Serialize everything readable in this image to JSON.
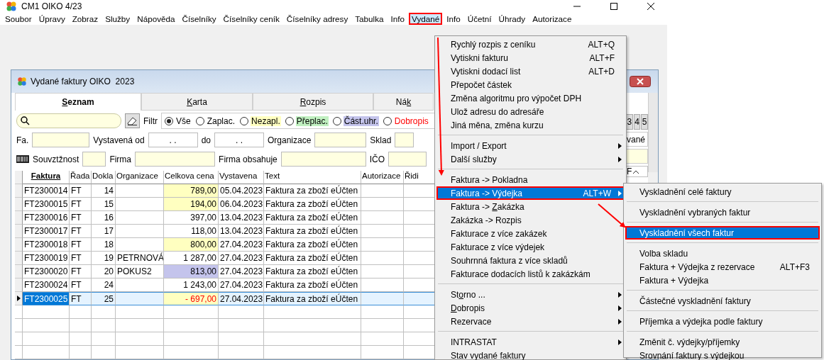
{
  "window": {
    "title": "CM1 OIKO 4/23"
  },
  "menu_bar": [
    {
      "label": "Soubor",
      "selected": false
    },
    {
      "label": "Úpravy",
      "selected": false
    },
    {
      "label": "Zobraz",
      "selected": false
    },
    {
      "label": "Služby",
      "selected": false
    },
    {
      "label": "Nápověda",
      "selected": false
    },
    {
      "label": "Číselníky",
      "selected": false
    },
    {
      "label": "Číselníky ceník",
      "selected": false
    },
    {
      "label": "Číselníky adresy",
      "selected": false
    },
    {
      "label": "Tabulka",
      "selected": false
    },
    {
      "label": "Info",
      "selected": false
    },
    {
      "label": "Vydané",
      "selected": true
    },
    {
      "label": "Info",
      "selected": false
    },
    {
      "label": "Účetní",
      "selected": false
    },
    {
      "label": "Úhrady",
      "selected": false
    },
    {
      "label": "Autorizace",
      "selected": false
    }
  ],
  "inner_window": {
    "title": "Vydané faktury OIKO  2023",
    "tabs": [
      {
        "label": {
          "key": "S",
          "post": "eznam"
        },
        "selected": true
      },
      {
        "label": {
          "key": "K",
          "post": "arta"
        },
        "selected": false
      },
      {
        "label": {
          "key": "R",
          "post": "ozpis"
        },
        "selected": false
      },
      {
        "label": {
          "pre": "Ná",
          "key": "k"
        },
        "selected": false
      }
    ],
    "filter": {
      "label": "Filtr",
      "options": [
        {
          "label": "Vše",
          "selected": true,
          "kind": "plain"
        },
        {
          "label": "Zaplac.",
          "selected": false,
          "kind": "plain"
        },
        {
          "label": "Nezapl.",
          "selected": false,
          "kind": "background",
          "color": "#ffffc0"
        },
        {
          "label": "Přeplac.",
          "selected": false,
          "kind": "background",
          "color": "#c0f0c0"
        },
        {
          "label": "Část.uhr.",
          "selected": false,
          "kind": "background",
          "color": "#c4c4ec"
        },
        {
          "label": "Dobropis",
          "selected": false,
          "kind": "text",
          "color": "#ff0000"
        }
      ]
    },
    "fields_row_1": [
      {
        "label": "Fa.",
        "kind": "yellow"
      },
      {
        "label": "Vystavená od",
        "kind": "date",
        "value": ". ."
      },
      {
        "label": "do",
        "kind": "date",
        "value": ". ."
      },
      {
        "label": "Organizace",
        "kind": "yellow"
      },
      {
        "label": "Sklad",
        "kind": "yellow"
      }
    ],
    "fields_row_2": [
      {
        "label": "Souvztžnost"
      },
      {
        "label": "Firma"
      },
      {
        "label": "Firma obsahuje"
      },
      {
        "label": "IČO"
      }
    ],
    "page_buttons": [
      "3",
      "4",
      "5"
    ],
    "side_field": "vané",
    "side_column": "F",
    "table": {
      "columns": [
        {
          "label": "Faktura",
          "sorted": true
        },
        {
          "label": "Řada",
          "sorted": false
        },
        {
          "label": "Dokla",
          "sorted": false
        },
        {
          "label": "Organizace",
          "sorted": false
        },
        {
          "label": "Celkova cena",
          "sorted": false
        },
        {
          "label": "Vystavena",
          "sorted": false
        },
        {
          "label": "Text",
          "sorted": false
        },
        {
          "label": "Autorizace",
          "sorted": false
        },
        {
          "label": "Řidi",
          "sorted": false
        }
      ],
      "rows": [
        {
          "faktura": "FT2300014",
          "rada": "FT",
          "doklad": "14",
          "cena": "789,00",
          "color": "#ffffc0",
          "negative": false,
          "vystavena": "05.04.2023",
          "text": "Faktura za zboží eÚčten",
          "selected": false
        },
        {
          "faktura": "FT2300015",
          "rada": "FT",
          "doklad": "15",
          "cena": "194,00",
          "color": "#ffffc0",
          "negative": false,
          "vystavena": "06.04.2023",
          "text": "Faktura za zboží eÚčten",
          "selected": false
        },
        {
          "faktura": "FT2300016",
          "rada": "FT",
          "doklad": "16",
          "cena": "397,00",
          "color": "#ffffff",
          "negative": false,
          "vystavena": "13.04.2023",
          "text": "Faktura za zboží eÚčten",
          "selected": false
        },
        {
          "faktura": "FT2300017",
          "rada": "FT",
          "doklad": "17",
          "cena": "118,00",
          "color": "#ffffff",
          "negative": false,
          "vystavena": "13.04.2023",
          "text": "Faktura za zboží eÚčten",
          "selected": false
        },
        {
          "faktura": "FT2300018",
          "rada": "FT",
          "doklad": "18",
          "cena": "800,00",
          "color": "#ffffc0",
          "negative": false,
          "vystavena": "27.04.2023",
          "text": "Faktura za zboží eÚčten",
          "selected": false
        },
        {
          "faktura": "FT2300019",
          "rada": "FT",
          "doklad": "19",
          "organizace": "PETRNOVÁ",
          "cena": "1 287,00",
          "color": "#ffffff",
          "negative": false,
          "vystavena": "27.04.2023",
          "text": "Faktura za zboží eÚčten",
          "selected": false
        },
        {
          "faktura": "FT2300020",
          "rada": "FT",
          "doklad": "20",
          "organizace": "POKUS2",
          "cena": "813,00",
          "color": "#c4c4ec",
          "negative": false,
          "vystavena": "27.04.2023",
          "text": "Faktura za zboží eÚčten",
          "selected": false
        },
        {
          "faktura": "FT2300024",
          "rada": "FT",
          "doklad": "24",
          "cena": "1 243,00",
          "color": "#ffffff",
          "negative": false,
          "vystavena": "27.04.2023",
          "text": "Faktura za zboží eÚčten",
          "selected": false
        },
        {
          "faktura": "FT2300025",
          "rada": "FT",
          "doklad": "25",
          "cena": "- 697,00",
          "color": "#ffffc0",
          "negative": true,
          "vystavena": "27.04.2023",
          "text": "Faktura za zboží eÚčten",
          "selected": true
        }
      ]
    }
  },
  "menu": {
    "groups": [
      [
        {
          "label": "Rychlý rozpis z ceníku",
          "shortcut": "ALT+Q",
          "submenu": false,
          "selected": false
        },
        {
          "label": "Vytiskni fakturu",
          "shortcut": "ALT+F",
          "submenu": false,
          "selected": false
        },
        {
          "label": "Vytiskni dodací list",
          "shortcut": "ALT+D",
          "submenu": false,
          "selected": false
        },
        {
          "label": "Přepočet  částek",
          "submenu": false,
          "selected": false
        },
        {
          "label": "Změna algoritmu pro výpočet DPH",
          "submenu": false,
          "selected": false
        },
        {
          "label": "Ulož adresu do adresáře",
          "submenu": false,
          "selected": false
        },
        {
          "label": "Jiná měna, změna kurzu",
          "submenu": false,
          "selected": false
        }
      ],
      [
        {
          "label": "Import / Export",
          "submenu": true,
          "selected": false
        },
        {
          "label": "Další služby",
          "submenu": true,
          "selected": false
        }
      ],
      [
        {
          "label": "Faktura -> Pokladna",
          "submenu": false,
          "selected": false
        },
        {
          "label": "Faktura -> Výdejka",
          "shortcut": "ALT+W",
          "submenu": true,
          "selected": true
        },
        {
          "label": {
            "pre": "Faktura -> ",
            "key": "Z",
            "post": "akázka"
          },
          "submenu": false,
          "selected": false
        },
        {
          "label": "Zakázka -> Rozpis",
          "submenu": false,
          "selected": false
        },
        {
          "label": "Fakturace z více zakázek",
          "submenu": false,
          "selected": false
        },
        {
          "label": "Fakturace z více výdejek",
          "submenu": false,
          "selected": false
        },
        {
          "label": "Souhrnná faktura z více skladů",
          "submenu": false,
          "selected": false
        },
        {
          "label": "Fakturace dodacích listů k zakázkám",
          "submenu": false,
          "selected": false
        }
      ],
      [
        {
          "label": {
            "pre": "St",
            "key": "o",
            "post": "rno ..."
          },
          "submenu": true,
          "selected": false
        },
        {
          "label": {
            "key": "D",
            "post": "obropis"
          },
          "submenu": true,
          "selected": false
        },
        {
          "label": "Rezervace",
          "submenu": true,
          "selected": false
        }
      ],
      [
        {
          "label": "INTRASTAT",
          "submenu": true,
          "selected": false
        },
        {
          "label": "Stav vydané faktury",
          "submenu": false,
          "selected": false
        }
      ]
    ]
  },
  "submenu": {
    "groups": [
      [
        {
          "label": "Vyskladnění celé faktury",
          "selected": false
        }
      ],
      [
        {
          "label": "Vyskladnění vybraných faktur",
          "selected": false
        }
      ],
      [
        {
          "label": "Vyskladnění všech faktur",
          "selected": true
        }
      ],
      [
        {
          "label": "Volba skladu",
          "selected": false
        },
        {
          "label": "Faktura + Výdejka z rezervace",
          "shortcut": "ALT+F3",
          "selected": false
        },
        {
          "label": "Faktura + Výdejka",
          "selected": false
        }
      ],
      [
        {
          "label": "Částečné vyskladnění faktury",
          "selected": false
        }
      ],
      [
        {
          "label": "Příjemka a výdejka podle faktury",
          "selected": false
        }
      ],
      [
        {
          "label": "Změnit č. výdejky/příjemky",
          "selected": false
        },
        {
          "label": "Srovnání faktury s výdejkou",
          "selected": false
        }
      ]
    ]
  }
}
